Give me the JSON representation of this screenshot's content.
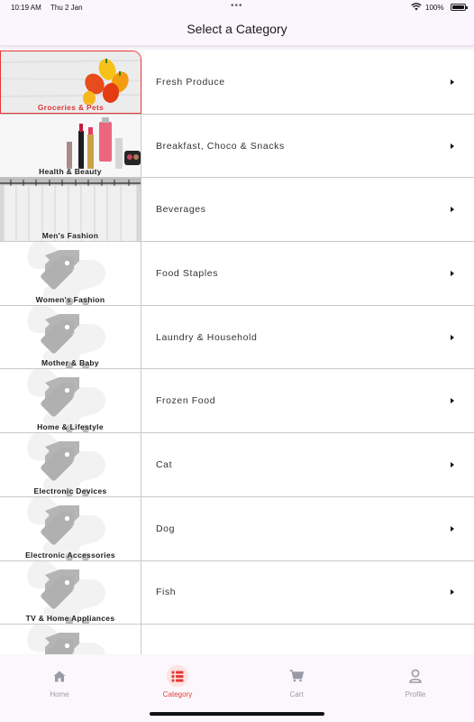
{
  "status_bar": {
    "time": "10:19 AM",
    "date": "Thu 2 Jan",
    "battery": "100%",
    "dots": "•••"
  },
  "header": {
    "title": "Select a Category"
  },
  "categories": [
    {
      "label": "Groceries & Pets",
      "selected": true
    },
    {
      "label": "Health & Beauty"
    },
    {
      "label": "Men's Fashion"
    },
    {
      "label": "Women's Fashion"
    },
    {
      "label": "Mother & Baby"
    },
    {
      "label": "Home & Lifestyle"
    },
    {
      "label": "Electronic Devices"
    },
    {
      "label": "Electronic Accessories"
    },
    {
      "label": "TV & Home Appliances"
    },
    {
      "label": ""
    }
  ],
  "subcategories": [
    {
      "label": "Fresh Produce"
    },
    {
      "label": "Breakfast, Choco & Snacks"
    },
    {
      "label": "Beverages"
    },
    {
      "label": "Food Staples"
    },
    {
      "label": "Laundry & Household"
    },
    {
      "label": "Frozen Food"
    },
    {
      "label": "Cat"
    },
    {
      "label": "Dog"
    },
    {
      "label": "Fish"
    },
    {
      "label": ""
    }
  ],
  "bottom_nav": {
    "items": [
      {
        "label": "Home",
        "icon": "home-icon"
      },
      {
        "label": "Category",
        "icon": "category-icon",
        "active": true
      },
      {
        "label": "Cart",
        "icon": "cart-icon"
      },
      {
        "label": "Profile",
        "icon": "profile-icon"
      }
    ]
  },
  "colors": {
    "accent": "#e53935",
    "accent_bg": "#fde3e2",
    "nav_inactive": "#9a9aa6",
    "header_bg": "#fbf5fd"
  }
}
